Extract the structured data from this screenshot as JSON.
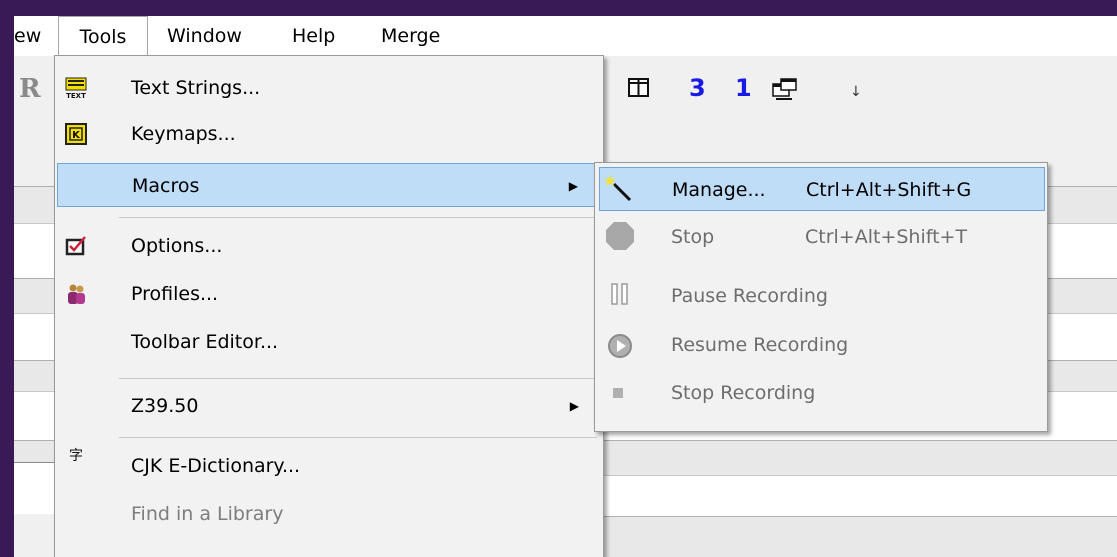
{
  "menubar": {
    "items": [
      {
        "label": "ew"
      },
      {
        "label": "Tools"
      },
      {
        "label": "Window"
      },
      {
        "label": "Help"
      },
      {
        "label": "Merge"
      }
    ]
  },
  "toolbar": {
    "partial_letter": "R",
    "num_three": "3",
    "num_one": "1",
    "overflow": "↓"
  },
  "tools_menu": {
    "items": [
      {
        "label": "Text Strings...",
        "icon": "text-strings-icon"
      },
      {
        "label": "Keymaps...",
        "icon": "keymap-icon"
      },
      {
        "label": "Macros",
        "arrow": "▶"
      },
      {
        "label": "Options...",
        "icon": "options-check-icon"
      },
      {
        "label": "Profiles...",
        "icon": "profiles-people-icon"
      },
      {
        "label": "Toolbar Editor..."
      },
      {
        "label": "Z39.50",
        "arrow": "▶"
      },
      {
        "label": "CJK E-Dictionary...",
        "icon": "cjk-icon"
      },
      {
        "label": "Find in a Library"
      }
    ]
  },
  "macros_submenu": {
    "items": [
      {
        "label": "Manage...",
        "shortcut": "Ctrl+Alt+Shift+G",
        "icon": "magic-wand-icon"
      },
      {
        "label": "Stop",
        "shortcut": "Ctrl+Alt+Shift+T",
        "icon": "stop-octagon-icon"
      },
      {
        "label": "Pause Recording",
        "icon": "pause-icon"
      },
      {
        "label": "Resume Recording",
        "icon": "resume-play-icon"
      },
      {
        "label": "Stop Recording",
        "icon": "stop-square-icon"
      }
    ]
  },
  "dialog": {
    "close_glyph": "✕"
  },
  "colors": {
    "highlight": "#bfddf7",
    "highlight_border": "#6fa6d9",
    "background": "#3a1a56"
  }
}
